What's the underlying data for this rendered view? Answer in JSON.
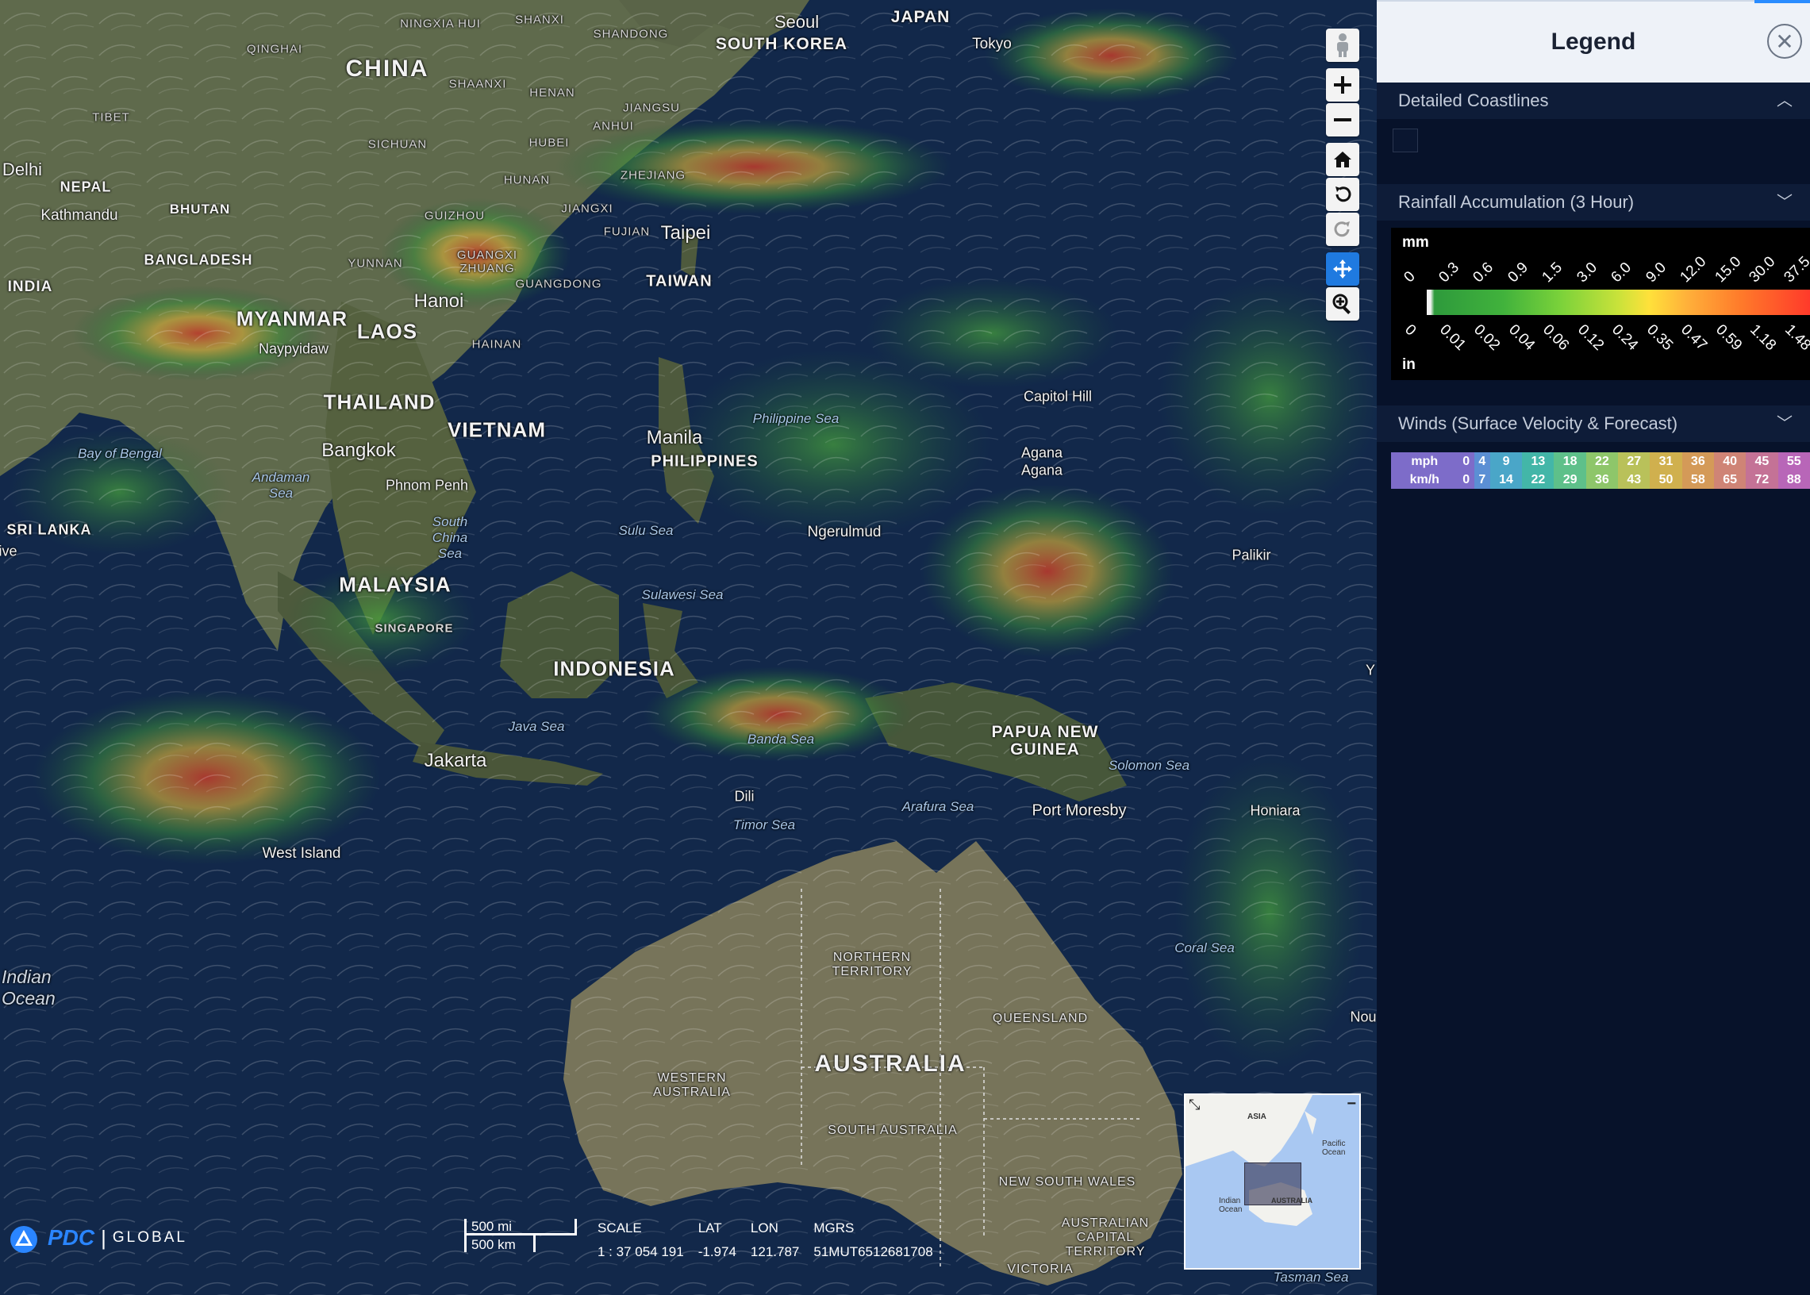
{
  "map": {
    "countries": [
      "CHINA",
      "MYANMAR",
      "LAOS",
      "THAILAND",
      "VIETNAM",
      "MALAYSIA",
      "INDONESIA",
      "PHILIPPINES",
      "TAIWAN",
      "SOUTH KOREA",
      "JAPAN",
      "INDIA",
      "BANGLADESH",
      "BHUTAN",
      "NEPAL",
      "SRI LANKA",
      "PAPUA NEW GUINEA",
      "AUSTRALIA",
      "TIBET",
      "SINGAPORE"
    ],
    "cities": [
      "Seoul",
      "Tokyo",
      "Delhi",
      "Kathmandu",
      "Taipei",
      "Hanoi",
      "Naypyidaw",
      "Bangkok",
      "Phnom Penh",
      "Manila",
      "Ngerulmud",
      "Capitol Hill",
      "Agana",
      "Agana",
      "Palikir",
      "Jakarta",
      "West Island",
      "Dili",
      "Port Moresby",
      "Honiara"
    ],
    "provinces": [
      "NINGXIA HUI",
      "SHANXI",
      "SHANDONG",
      "QINGHAI",
      "SHAANXI",
      "HENAN",
      "JIANGSU",
      "ANHUI",
      "SICHUAN",
      "HUBEI",
      "HUNAN",
      "ZHEJIANG",
      "JIANGXI",
      "GUIZHOU",
      "FUJIAN",
      "YUNNAN",
      "GUANGXI ZHUANG",
      "GUANGDONG",
      "HAINAN",
      "NORTHERN TERRITORY",
      "QUEENSLAND",
      "WESTERN AUSTRALIA",
      "SOUTH AUSTRALIA",
      "NEW SOUTH WALES",
      "AUSTRALIAN CAPITAL TERRITORY",
      "VICTORIA"
    ],
    "seas": [
      "Bay of Bengal",
      "Andaman Sea",
      "South China Sea",
      "Philippine Sea",
      "Sulu Sea",
      "Sulawesi Sea",
      "Java Sea",
      "Banda Sea",
      "Arafura Sea",
      "Timor Sea",
      "Solomon Sea",
      "Coral Sea",
      "Indian Ocean",
      "Tasman Sea"
    ],
    "edge_labels": [
      "ive",
      "Y",
      "Nou"
    ]
  },
  "toolbar": {
    "buttons": [
      "street-view",
      "zoom-in",
      "zoom-out",
      "home",
      "rotate-left",
      "rotate-right",
      "pan",
      "zoom-box"
    ]
  },
  "minimap": {
    "labels": {
      "asia": "ASIA",
      "pacific": "Pacific Ocean",
      "indian": "Indian Ocean",
      "australia": "AUSTRALIA"
    }
  },
  "logo": {
    "brand": "PDC",
    "sep": "|",
    "suffix": "GLOBAL"
  },
  "scale": {
    "miles": "500 mi",
    "km": "500 km"
  },
  "coords": {
    "scale_label": "SCALE",
    "scale_value": "1 : 37 054 191",
    "lat_label": "LAT",
    "lat_value": "-1.974",
    "lon_label": "LON",
    "lon_value": "121.787",
    "mgrs_label": "MGRS",
    "mgrs_value": "51MUT6512681708"
  },
  "legend": {
    "title": "Legend",
    "sections": [
      {
        "label": "Detailed Coastlines",
        "chevron": "︿"
      },
      {
        "label": "Rainfall Accumulation (3 Hour)",
        "chevron": "﹀"
      },
      {
        "label": "Winds (Surface Velocity & Forecast)",
        "chevron": "﹀"
      }
    ],
    "rain": {
      "unit_top": "mm",
      "unit_bottom": "in",
      "mm_ticks": [
        "0",
        "0.3",
        "0.6",
        "0.9",
        "1.5",
        "3.0",
        "6.0",
        "9.0",
        "12.0",
        "15.0",
        "30.0",
        "37.5"
      ],
      "in_ticks": [
        "0",
        "0.01",
        "0.02",
        "0.04",
        "0.06",
        "0.12",
        "0.24",
        "0.35",
        "0.47",
        "0.59",
        "1.18",
        "1.48"
      ]
    },
    "wind": {
      "mph_label": "mph",
      "kmh_label": "km/h",
      "mph": [
        "0",
        "4",
        "9",
        "13",
        "18",
        "22",
        "27",
        "31",
        "36",
        "40",
        "45",
        "55"
      ],
      "kmh": [
        "0",
        "7",
        "14",
        "22",
        "29",
        "36",
        "43",
        "50",
        "58",
        "65",
        "72",
        "88"
      ],
      "colors": [
        "#7d6cc9",
        "#5b8fd4",
        "#4aa6c8",
        "#43b6a8",
        "#5ec08a",
        "#8ec66a",
        "#b9c15a",
        "#d0b04e",
        "#d49a58",
        "#cf8476",
        "#c47296",
        "#b866b8"
      ]
    }
  }
}
